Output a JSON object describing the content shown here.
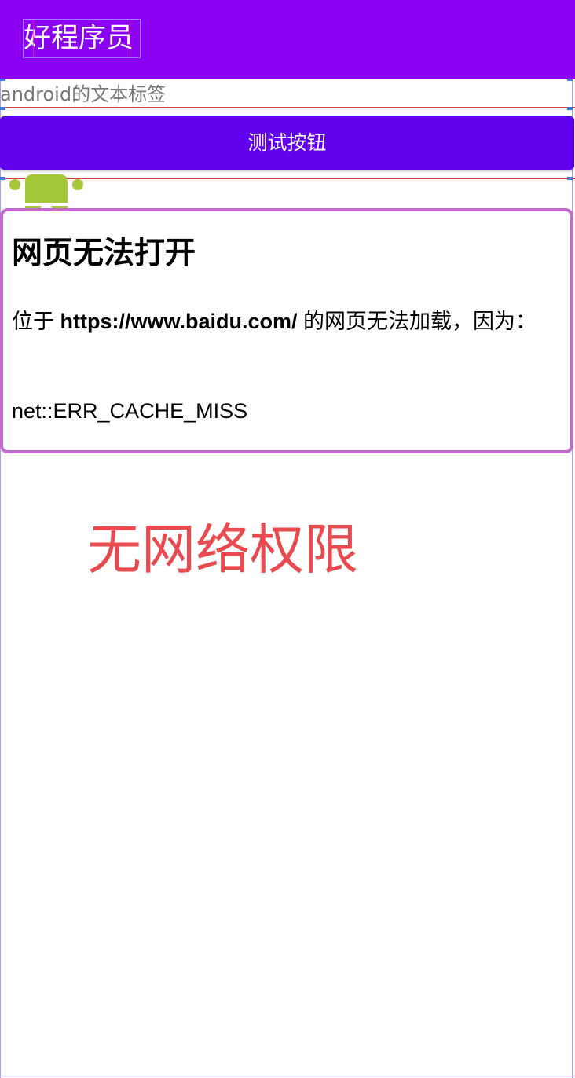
{
  "app_bar": {
    "title": "好程序员",
    "background_color": "#8a00f2"
  },
  "text_label": {
    "text": "android的文本标签"
  },
  "test_button": {
    "label": "测试按钮",
    "background_color": "#6200ee"
  },
  "android_logo": {
    "icon": "android-robot-icon",
    "color": "#a4c639"
  },
  "webview": {
    "heading": "网页无法打开",
    "message_prefix": "位于 ",
    "url": "https://www.baidu.com/",
    "message_suffix": " 的网页无法加载，因为：",
    "error_code": "net::ERR_CACHE_MISS",
    "border_color": "#c26bcc"
  },
  "annotation": {
    "text": "无网络权限",
    "color": "#e84a50"
  }
}
